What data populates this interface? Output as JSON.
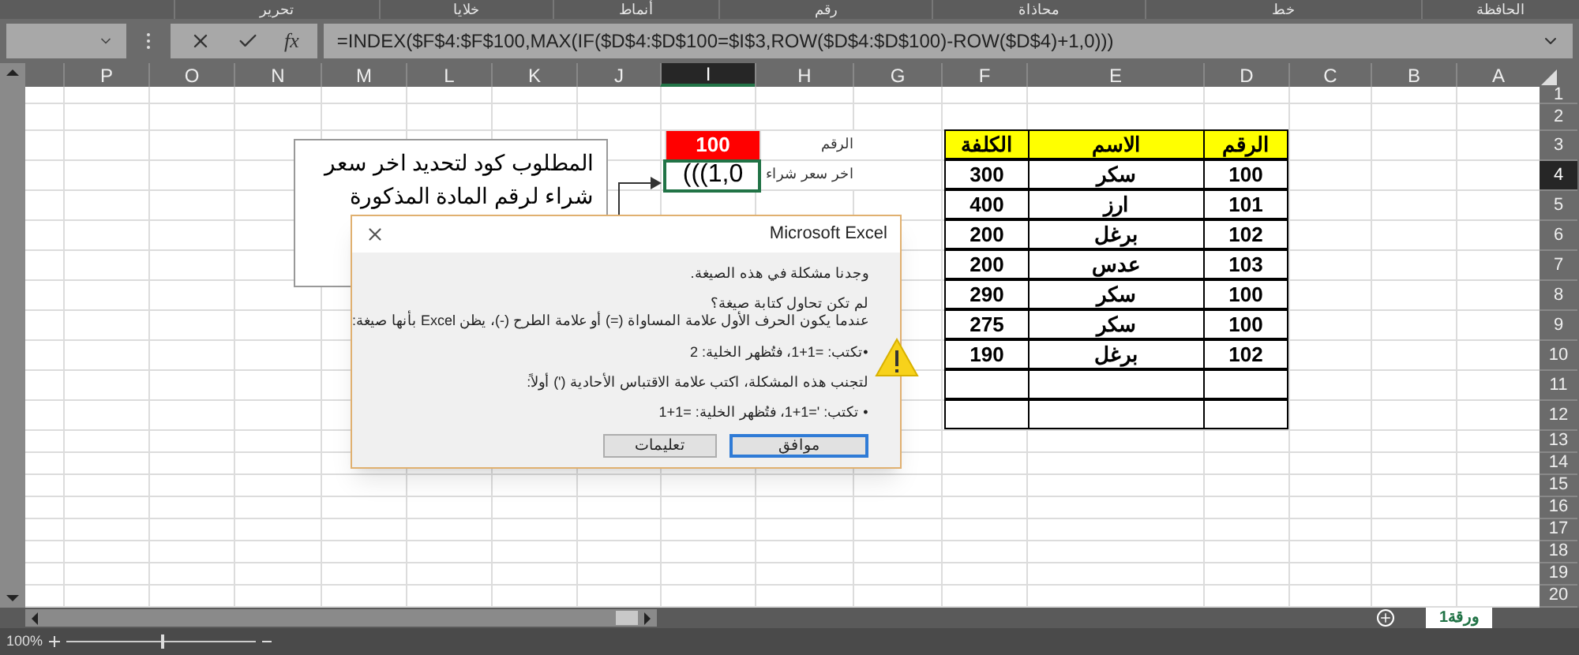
{
  "ribbon_groups": [
    "الحافظة",
    "خط",
    "محاذاة",
    "رقم",
    "أنماط",
    "خلايا",
    "تحرير"
  ],
  "formula_bar": {
    "fx": "fx",
    "formula": "=INDEX($F$4:$F$100,MAX(IF($D$4:$D$100=$I$3,ROW($D$4:$D$100)-ROW($D$4)+1,0)))"
  },
  "columns": [
    {
      "label": "A",
      "selected": false
    },
    {
      "label": "B",
      "selected": false
    },
    {
      "label": "C",
      "selected": false
    },
    {
      "label": "D",
      "selected": false
    },
    {
      "label": "E",
      "selected": false
    },
    {
      "label": "F",
      "selected": false
    },
    {
      "label": "G",
      "selected": false
    },
    {
      "label": "H",
      "selected": false
    },
    {
      "label": "I",
      "selected": true
    },
    {
      "label": "J",
      "selected": false
    },
    {
      "label": "K",
      "selected": false
    },
    {
      "label": "L",
      "selected": false
    },
    {
      "label": "M",
      "selected": false
    },
    {
      "label": "N",
      "selected": false
    },
    {
      "label": "O",
      "selected": false
    },
    {
      "label": "P",
      "selected": false
    }
  ],
  "rows": [
    {
      "label": "1",
      "selected": false
    },
    {
      "label": "2",
      "selected": false
    },
    {
      "label": "3",
      "selected": false
    },
    {
      "label": "4",
      "selected": true
    },
    {
      "label": "5",
      "selected": false
    },
    {
      "label": "6",
      "selected": false
    },
    {
      "label": "7",
      "selected": false
    },
    {
      "label": "8",
      "selected": false
    },
    {
      "label": "9",
      "selected": false
    },
    {
      "label": "10",
      "selected": false
    },
    {
      "label": "11",
      "selected": false
    },
    {
      "label": "12",
      "selected": false
    },
    {
      "label": "13",
      "selected": false
    },
    {
      "label": "14",
      "selected": false
    },
    {
      "label": "15",
      "selected": false
    },
    {
      "label": "16",
      "selected": false
    },
    {
      "label": "17",
      "selected": false
    },
    {
      "label": "18",
      "selected": false
    },
    {
      "label": "19",
      "selected": false
    },
    {
      "label": "20",
      "selected": false
    }
  ],
  "data_table": {
    "header": [
      "الرقم",
      "الاسم",
      "الكلفة"
    ],
    "rows": [
      [
        "100",
        "سكر",
        "300"
      ],
      [
        "101",
        "ارز",
        "400"
      ],
      [
        "102",
        "برغل",
        "200"
      ],
      [
        "103",
        "عدس",
        "200"
      ],
      [
        "100",
        "سكر",
        "290"
      ],
      [
        "100",
        "سكر",
        "275"
      ],
      [
        "102",
        "برغل",
        "190"
      ]
    ]
  },
  "lookup": [
    {
      "label": "الرقم",
      "value": "100",
      "kind": "input",
      "selected": false
    },
    {
      "label": "اخر سعر شراء",
      "value": "1,0)))",
      "kind": "result",
      "selected": true
    }
  ],
  "note_box": {
    "text": "المطلوب كود لتحديد اخر سعر شراء لرقم المادة المذكورة"
  },
  "dialog": {
    "title": "Microsoft Excel",
    "paragraphs": [
      "وجدنا مشكلة في هذه الصيغة.",
      "لم تكن تحاول كتابة صيغة؟",
      "عندما يكون الحرف الأول علامة المساواة (=) أو علامة الطرح (-)، يظن Excel بأنها صيغة:",
      "•تكتب:   =1+1، فتُظهر الخلية:   2",
      "لتجنب هذه المشكلة، اكتب علامة الاقتباس الأحادية (') أولاً:",
      "• تكتب:   '=1+1، فتُظهر الخلية:   =1+1"
    ],
    "buttons": [
      {
        "label": "موافق",
        "default": true
      },
      {
        "label": "تعليمات",
        "default": false
      }
    ]
  },
  "sheet_tabs": [
    {
      "label": "ورقة1",
      "selected": true
    }
  ],
  "status_bar": {
    "zoom": "100%",
    "level": 0.5
  }
}
